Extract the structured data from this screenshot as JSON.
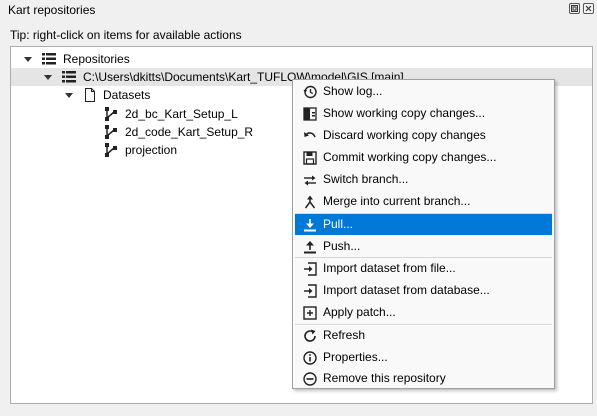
{
  "window": {
    "title": "Kart repositories",
    "float_icon": "float-icon",
    "close_icon": "close-icon"
  },
  "tip": "Tip: right-click on items for available actions",
  "tree": {
    "root": {
      "label": "Repositories",
      "icon": "database-list-icon"
    },
    "repo": {
      "label": "C:\\Users\\dkitts\\Documents\\Kart_TUFLOW\\model\\GIS [main]",
      "icon": "database-list-icon"
    },
    "datasets": {
      "label": "Datasets",
      "icon": "document-icon"
    },
    "items": [
      {
        "label": "2d_bc_Kart_Setup_L",
        "icon": "polyline-icon"
      },
      {
        "label": "2d_code_Kart_Setup_R",
        "icon": "polyline-icon"
      },
      {
        "label": "projection",
        "icon": "polyline-icon"
      }
    ]
  },
  "context_menu": {
    "items": [
      {
        "label": "Show log...",
        "icon": "history-icon"
      },
      {
        "label": "Show working copy changes...",
        "icon": "diff-icon"
      },
      {
        "label": "Discard working copy changes",
        "icon": "undo-icon"
      },
      {
        "label": "Commit working copy changes...",
        "icon": "save-icon"
      },
      {
        "label": "Switch branch...",
        "icon": "switch-icon"
      },
      {
        "label": "Merge into current branch...",
        "icon": "merge-icon"
      },
      {
        "label": "Pull...",
        "icon": "pull-icon",
        "active": true
      },
      {
        "label": "Push...",
        "icon": "push-icon"
      },
      {
        "label": "Import dataset from file...",
        "icon": "import-icon"
      },
      {
        "label": "Import dataset from database...",
        "icon": "import-icon"
      },
      {
        "label": "Apply patch...",
        "icon": "patch-icon"
      },
      {
        "label": "Refresh",
        "icon": "refresh-icon"
      },
      {
        "label": "Properties...",
        "icon": "info-icon"
      },
      {
        "label": "Remove this repository",
        "icon": "remove-icon"
      }
    ]
  },
  "colors": {
    "highlight": "#0078d7",
    "selected_row": "#e5e5e5"
  }
}
